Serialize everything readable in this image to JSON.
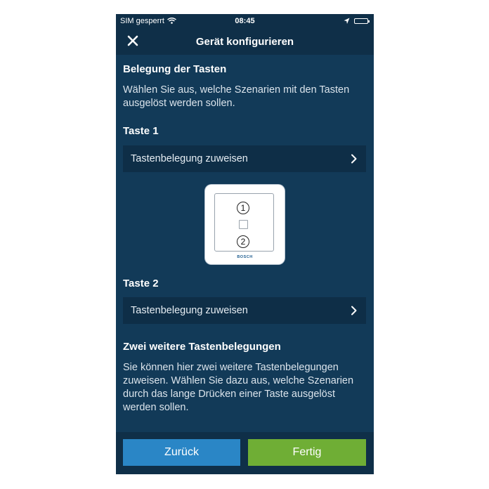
{
  "status_bar": {
    "carrier": "SIM gesperrt",
    "time": "08:45"
  },
  "header": {
    "title": "Gerät konfigurieren",
    "close_icon": "close-icon"
  },
  "section_assignment": {
    "heading": "Belegung der Tasten",
    "description": "Wählen Sie aus, welche Szenarien mit den Tasten ausgelöst werden sollen."
  },
  "button1": {
    "label": "Taste 1",
    "action": "Tastenbelegung zuweisen"
  },
  "device_image": {
    "button1_number": "1",
    "button2_number": "2",
    "brand": "BOSCH"
  },
  "button2": {
    "label": "Taste 2",
    "action": "Tastenbelegung zuweisen"
  },
  "section_extra": {
    "heading": "Zwei weitere Tastenbelegungen",
    "description": "Sie können hier zwei weitere Tastenbelegungen zuweisen. Wählen Sie dazu aus, welche Szenarien durch das lange Drücken einer Taste ausgelöst werden sollen."
  },
  "footer": {
    "back_label": "Zurück",
    "done_label": "Fertig"
  },
  "colors": {
    "background": "#123a58",
    "bar": "#0f2f48",
    "back_button": "#2a86c6",
    "done_button": "#6fae35"
  }
}
